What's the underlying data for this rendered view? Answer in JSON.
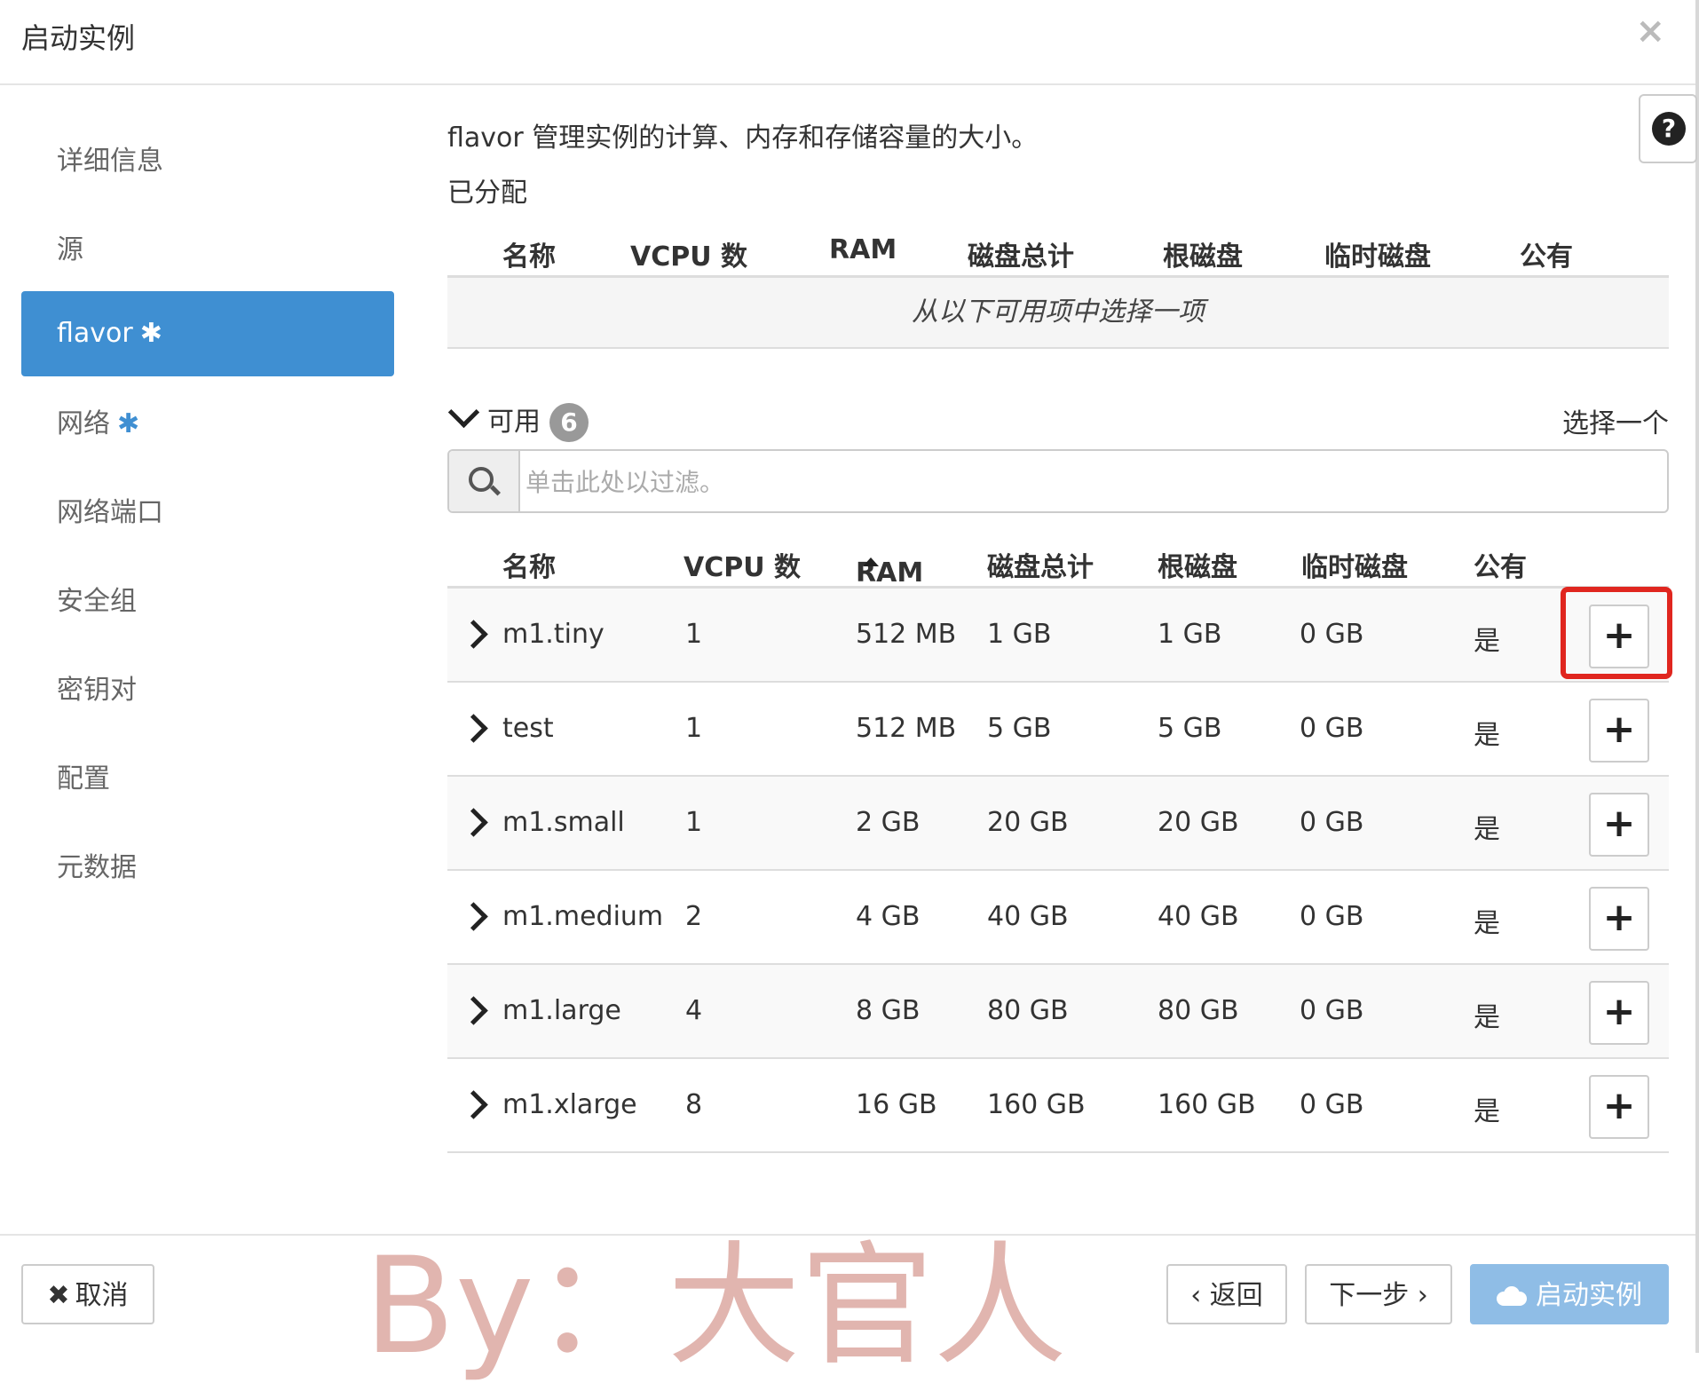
{
  "dialog": {
    "title": "启动实例",
    "close": "×"
  },
  "sidebar": {
    "items": [
      {
        "label": "详细信息",
        "required": ""
      },
      {
        "label": "源",
        "required": ""
      },
      {
        "label": "flavor",
        "required": "✱"
      },
      {
        "label": "网络",
        "required": "✱"
      },
      {
        "label": "网络端口",
        "required": ""
      },
      {
        "label": "安全组",
        "required": ""
      },
      {
        "label": "密钥对",
        "required": ""
      },
      {
        "label": "配置",
        "required": ""
      },
      {
        "label": "元数据",
        "required": ""
      }
    ],
    "active_index": 2
  },
  "help": {
    "icon": "?"
  },
  "main": {
    "description": "flavor 管理实例的计算、内存和存储容量的大小。",
    "allocated_label": "已分配",
    "allocated_empty": "从以下可用项中选择一项",
    "available_label": "可用",
    "available_count": "6",
    "select_one": "选择一个",
    "search_placeholder": "单击此处以过滤。",
    "columns": [
      "名称",
      "VCPU 数",
      "RAM",
      "磁盘总计",
      "根磁盘",
      "临时磁盘",
      "公有"
    ],
    "rows": [
      {
        "name": "m1.tiny",
        "vcpu": "1",
        "ram": "512 MB",
        "disk": "1 GB",
        "root": "1 GB",
        "ephemeral": "0 GB",
        "public": "是"
      },
      {
        "name": "test",
        "vcpu": "1",
        "ram": "512 MB",
        "disk": "5 GB",
        "root": "5 GB",
        "ephemeral": "0 GB",
        "public": "是"
      },
      {
        "name": "m1.small",
        "vcpu": "1",
        "ram": "2 GB",
        "disk": "20 GB",
        "root": "20 GB",
        "ephemeral": "0 GB",
        "public": "是"
      },
      {
        "name": "m1.medium",
        "vcpu": "2",
        "ram": "4 GB",
        "disk": "40 GB",
        "root": "40 GB",
        "ephemeral": "0 GB",
        "public": "是"
      },
      {
        "name": "m1.large",
        "vcpu": "4",
        "ram": "8 GB",
        "disk": "80 GB",
        "root": "80 GB",
        "ephemeral": "0 GB",
        "public": "是"
      },
      {
        "name": "m1.xlarge",
        "vcpu": "8",
        "ram": "16 GB",
        "disk": "160 GB",
        "root": "160 GB",
        "ephemeral": "0 GB",
        "public": "是"
      }
    ],
    "add_label": "+"
  },
  "footer": {
    "cancel": "取消",
    "back": "‹ 返回",
    "next": "下一步 ›",
    "launch": "启动实例"
  },
  "watermark": "By：大官人",
  "colors": {
    "accent": "#3f8fd2",
    "highlight": "#e0261f",
    "launch_disabled": "#8fbde6"
  }
}
